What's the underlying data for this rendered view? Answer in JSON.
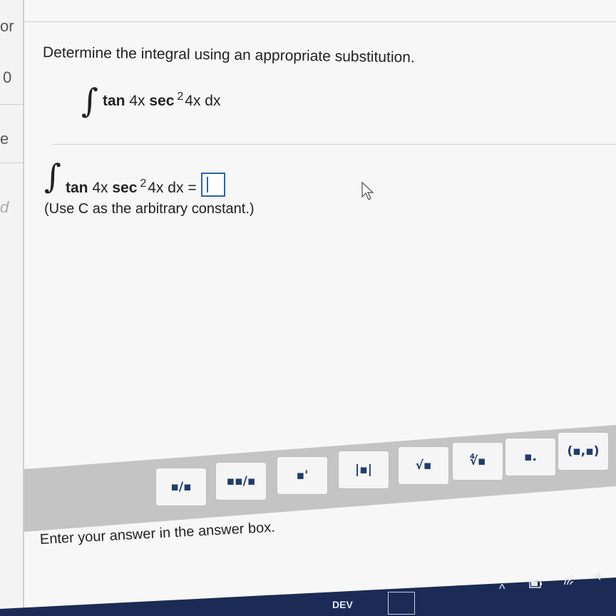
{
  "left_strip": {
    "fragments": [
      "or",
      "0",
      "e",
      "d"
    ]
  },
  "question": {
    "prompt": "Determine the integral using an appropriate substitution.",
    "integral": {
      "sign": "∫",
      "func1": "tan",
      "arg1": "4x",
      "func2": "sec",
      "exponent": "2",
      "arg2": "4x dx"
    }
  },
  "answer": {
    "lhs_sign": "∫",
    "lhs_func1": "tan",
    "lhs_arg1": "4x",
    "lhs_func2": "sec",
    "lhs_exponent": "2",
    "lhs_arg2": "4x dx =",
    "value": "",
    "hint": "(Use C as the arbitrary constant.)"
  },
  "toolbar": {
    "buttons": [
      {
        "name": "fraction-button",
        "glyph": "▪/▪"
      },
      {
        "name": "mixed-number-button",
        "glyph": "▪▪/▪"
      },
      {
        "name": "exponent-button",
        "glyph": "▪'"
      },
      {
        "name": "absolute-value-button",
        "glyph": "|▪|"
      },
      {
        "name": "square-root-button",
        "glyph": "√▪"
      },
      {
        "name": "nth-root-button",
        "glyph": "∜▪"
      },
      {
        "name": "decimal-button",
        "glyph": "▪."
      },
      {
        "name": "interval-button",
        "glyph": "(▪,▪)"
      }
    ]
  },
  "footer": {
    "instruction": "Enter your answer in the answer box."
  },
  "taskbar": {
    "dev_label": "DEV",
    "chevron": "^",
    "tray": [
      "battery-icon",
      "wifi-icon",
      "volume-icon"
    ]
  }
}
